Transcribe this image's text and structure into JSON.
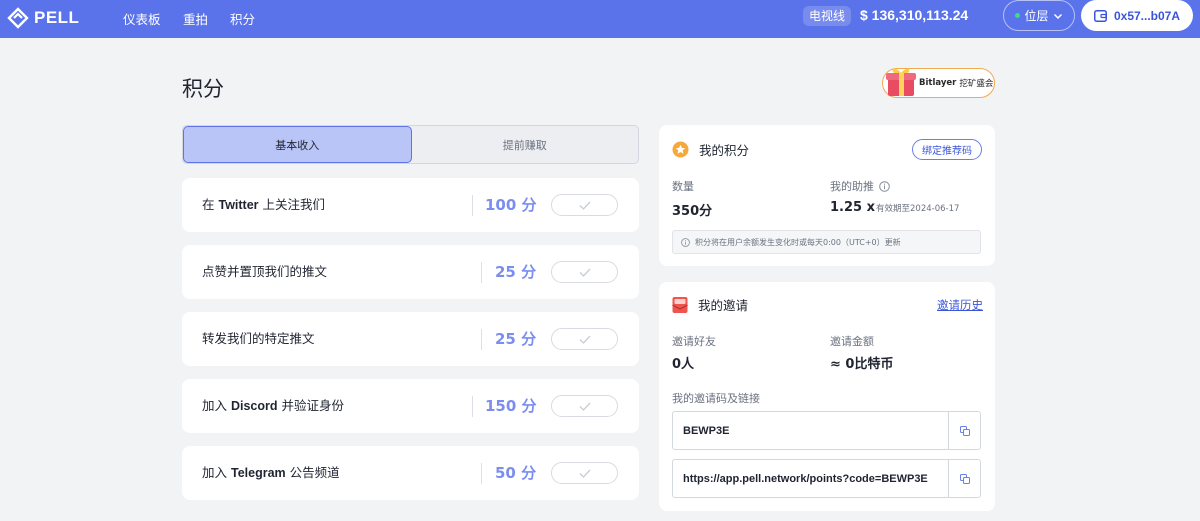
{
  "nav": {
    "brand": "PELL",
    "items": [
      "仪表板",
      "重拍",
      "积分"
    ],
    "tvl_label": "电视线",
    "tvl_value": "$ 136,310,113.24",
    "layer_label": "位层",
    "wallet_address": "0x57...b07A"
  },
  "page": {
    "title": "积分",
    "promo_brand": "Bitlayer",
    "promo_text": "挖矿盛会"
  },
  "tabs": [
    {
      "label": "基本收入",
      "active": true
    },
    {
      "label": "提前赚取",
      "active": false
    }
  ],
  "tasks": [
    {
      "prefix": "在 ",
      "bold": "Twitter",
      "suffix": " 上关注我们",
      "points": "100 分"
    },
    {
      "prefix": "",
      "bold": "",
      "suffix": "点赞并置顶我们的推文",
      "points": "25 分"
    },
    {
      "prefix": "",
      "bold": "",
      "suffix": "转发我们的特定推文",
      "points": "25 分"
    },
    {
      "prefix": "加入 ",
      "bold": "Discord",
      "suffix": " 并验证身份",
      "points": "150 分"
    },
    {
      "prefix": "加入 ",
      "bold": "Telegram",
      "suffix": " 公告频道",
      "points": "50 分"
    }
  ],
  "points_card": {
    "title": "我的积分",
    "bind_button": "绑定推荐码",
    "quantity_label": "数量",
    "quantity_value": "350分",
    "boost_label": "我的助推",
    "boost_value": "1.25 x",
    "boost_expiry": "有效期至2024-06-17",
    "note": "积分将在用户余额发生变化时或每天0:00（UTC+0）更新"
  },
  "invite_card": {
    "title": "我的邀请",
    "history_link": "邀请历史",
    "friends_label": "邀请好友",
    "friends_value": "0人",
    "amount_label": "邀请金额",
    "amount_value": "≈ 0比特币",
    "code_label": "我的邀请码及链接",
    "code": "BEWP3E",
    "link": "https://app.pell.network/points?code=BEWP3E"
  },
  "colors": {
    "nav_bg": "#5b73ea",
    "accent": "#3b55d9",
    "points": "#7b8ef0",
    "tab_active": "#b9c4f7"
  }
}
